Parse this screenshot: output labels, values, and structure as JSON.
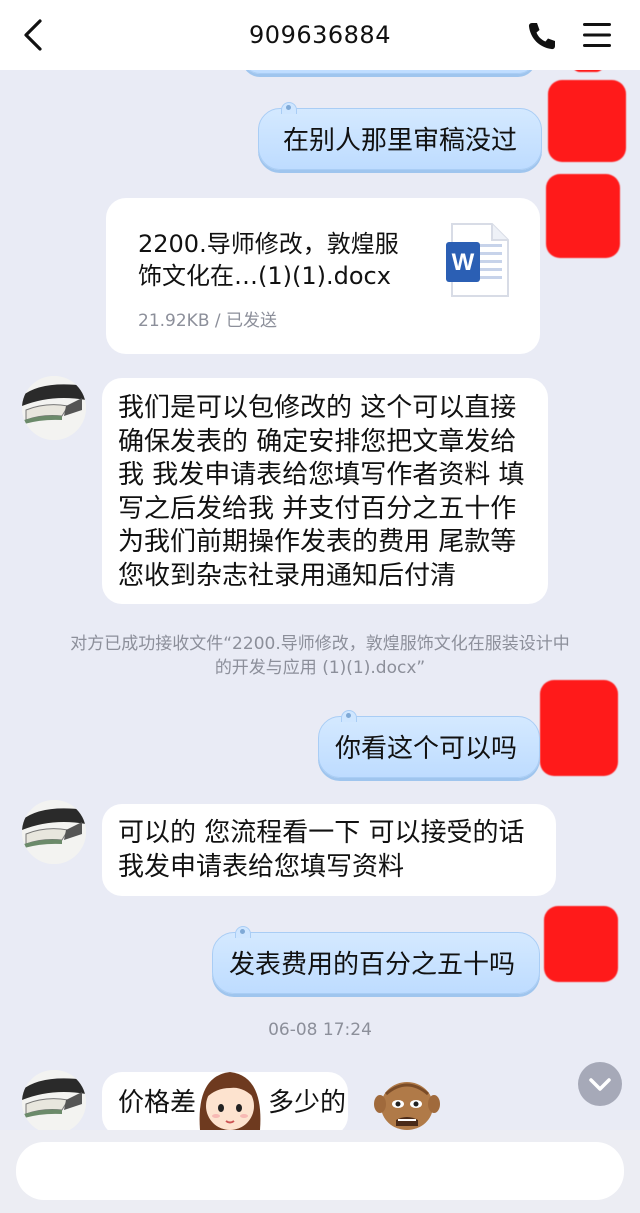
{
  "header": {
    "title": "909636884",
    "back_icon": "chevron-left-icon",
    "call_icon": "phone-icon",
    "menu_icon": "hamburger-menu-icon"
  },
  "messages": {
    "m1": {
      "text": "在别人那里审稿没过"
    },
    "file": {
      "name_line1": "2200.导师修改，敦煌服",
      "name_line2": "饰文化在…(1)(1).docx",
      "meta": "21.92KB / 已发送",
      "icon_letter": "W"
    },
    "m2": {
      "lines": [
        "我们是可以包修改的 这个可以直接",
        "确保发表的 确定安排您把文章发给",
        "我 我发申请表给您填写作者资料 填",
        "写之后发给我 并支付百分之五十作",
        "为我们前期操作发表的费用 尾款等",
        "您收到杂志社录用通知后付清"
      ]
    },
    "sys": {
      "line1": "对方已成功接收文件“2200.导师修改，敦煌服饰文化在服装设计中",
      "line2": "的开发与应用 (1)(1).docx”"
    },
    "m3": {
      "text": "你看这个可以吗"
    },
    "m4": {
      "lines": [
        "可以的 您流程看一下 可以接受的话",
        "我发申请表给您填写资料"
      ]
    },
    "m5": {
      "text": "发表费用的百分之五十吗"
    },
    "timestamp": "06-08 17:24",
    "m6": {
      "text_left": "价格差",
      "text_right": "多少的"
    }
  },
  "colors": {
    "background": "#e9ebf5",
    "outgoing_bubble": "#c8e2ff",
    "incoming_bubble": "#ffffff",
    "redaction": "#ff1a1a",
    "word_icon": "#2b5fb4"
  }
}
